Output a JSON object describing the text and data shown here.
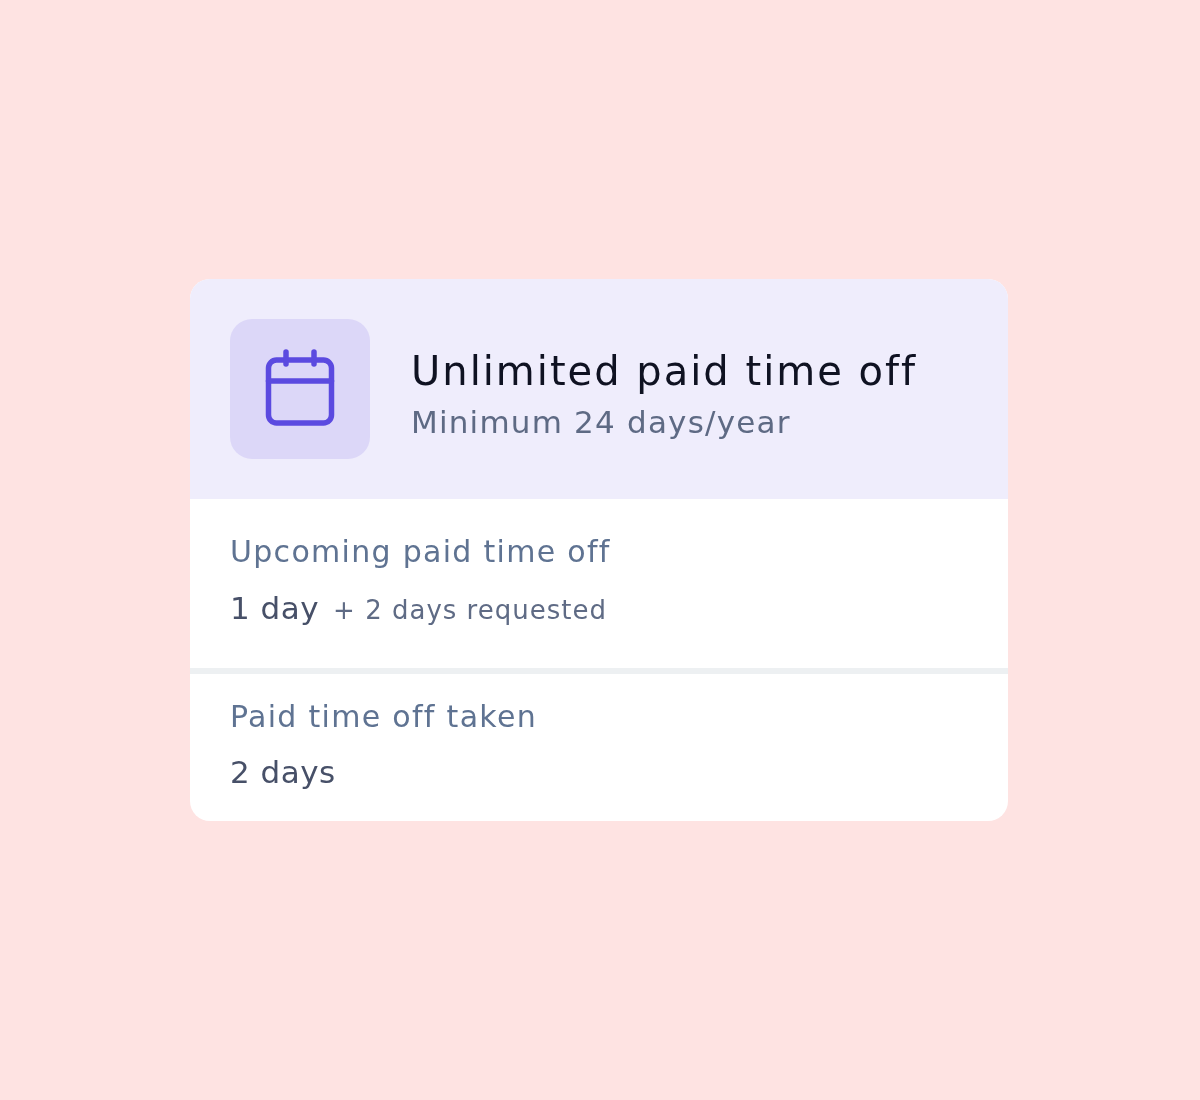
{
  "card": {
    "header": {
      "title": "Unlimited paid time off",
      "subtitle": "Minimum 24 days/year"
    },
    "sections": [
      {
        "label": "Upcoming paid time off",
        "value": "1 day",
        "note": "+ 2 days requested"
      },
      {
        "label": "Paid time off taken",
        "value": "2 days"
      }
    ]
  }
}
